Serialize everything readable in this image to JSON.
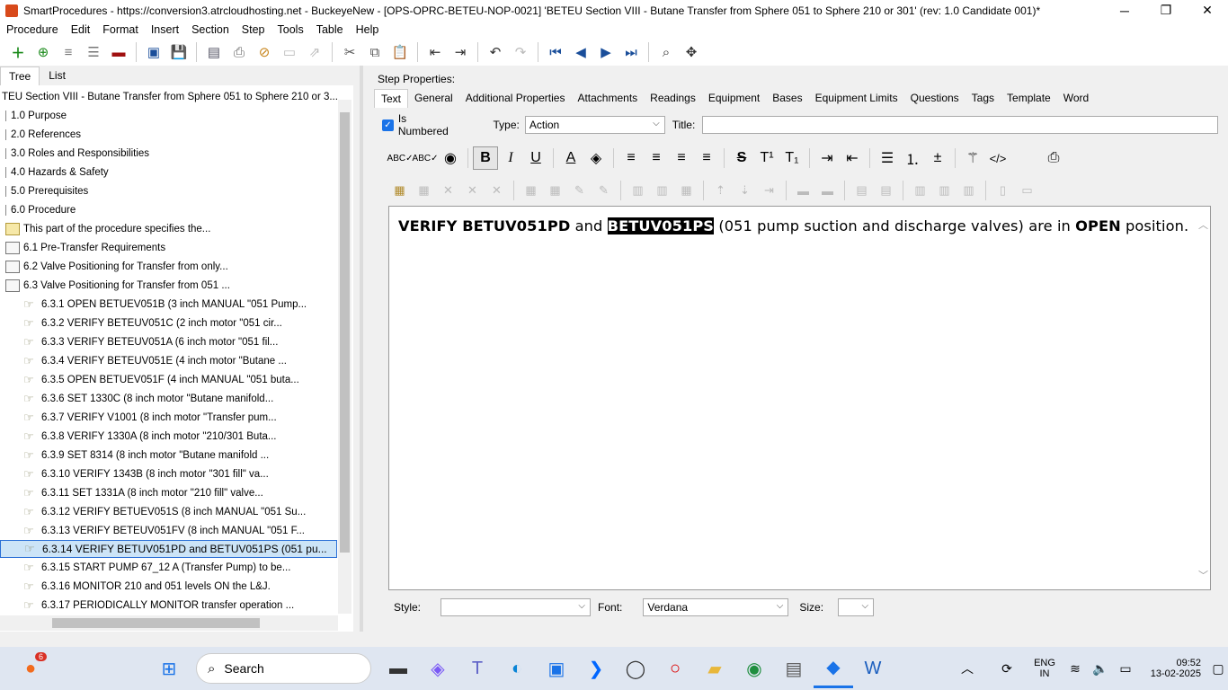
{
  "window": {
    "title": "SmartProcedures - https://conversion3.atrcloudhosting.net - BuckeyeNew - [OPS-OPRC-BETEU-NOP-0021] 'BETEU Section VIII - Butane Transfer from Sphere 051 to Sphere 210 or 301' (rev: 1.0 Candidate 001)*",
    "minimize": "─",
    "maximize": "❐",
    "close": "✕"
  },
  "menu": [
    "Procedure",
    "Edit",
    "Format",
    "Insert",
    "Section",
    "Step",
    "Tools",
    "Table",
    "Help"
  ],
  "left": {
    "tabs": [
      "Tree",
      "List"
    ],
    "tree": [
      {
        "label": "TEU Section VIII - Butane Transfer from Sphere 051 to Sphere 210 or 3...",
        "icon": "none",
        "indent": 0
      },
      {
        "label": "1.0 Purpose",
        "icon": "branch",
        "indent": 1
      },
      {
        "label": "2.0 References",
        "icon": "branch",
        "indent": 1
      },
      {
        "label": "3.0 Roles and Responsibilities",
        "icon": "branch",
        "indent": 1
      },
      {
        "label": "4.0 Hazards & Safety",
        "icon": "branch",
        "indent": 1
      },
      {
        "label": "5.0 Prerequisites",
        "icon": "branch",
        "indent": 1
      },
      {
        "label": "6.0 Procedure",
        "icon": "branch",
        "indent": 1
      },
      {
        "label": "This part of the procedure specifies the...",
        "icon": "note",
        "indent": 1
      },
      {
        "label": "6.1 Pre-Transfer Requirements",
        "icon": "doc",
        "indent": 1
      },
      {
        "label": "6.2 Valve Positioning for Transfer from only...",
        "icon": "doc",
        "indent": 1
      },
      {
        "label": "6.3 Valve Positioning for Transfer from 051 ...",
        "icon": "doc",
        "indent": 1
      },
      {
        "label": "6.3.1 OPEN BETUEV051B (3 inch MANUAL \"051 Pump...",
        "icon": "hand",
        "indent": 2
      },
      {
        "label": "6.3.2 VERIFY BETEUV051C (2 inch motor \"051 cir...",
        "icon": "hand",
        "indent": 2
      },
      {
        "label": "6.3.3 VERIFY BETEUV051A (6 inch motor \"051 fil...",
        "icon": "hand",
        "indent": 2
      },
      {
        "label": "6.3.4 VERIFY BETEUV051E (4 inch motor \"Butane ...",
        "icon": "hand",
        "indent": 2
      },
      {
        "label": "6.3.5 OPEN BETUEV051F (4 inch MANUAL \"051 buta...",
        "icon": "hand",
        "indent": 2
      },
      {
        "label": "6.3.6 SET 1330C (8 inch motor \"Butane manifold...",
        "icon": "hand",
        "indent": 2
      },
      {
        "label": "6.3.7 VERIFY V1001 (8 inch motor \"Transfer pum...",
        "icon": "hand",
        "indent": 2
      },
      {
        "label": "6.3.8 VERIFY 1330A (8 inch motor \"210/301 Buta...",
        "icon": "hand",
        "indent": 2
      },
      {
        "label": "6.3.9 SET 8314 (8 inch motor \"Butane manifold ...",
        "icon": "hand",
        "indent": 2
      },
      {
        "label": "6.3.10 VERIFY 1343B (8 inch motor \"301 fill\" va...",
        "icon": "hand",
        "indent": 2
      },
      {
        "label": "6.3.11 SET 1331A (8 inch motor \"210 fill\" valve...",
        "icon": "hand",
        "indent": 2
      },
      {
        "label": "6.3.12 VERIFY BETUEV051S (8 inch MANUAL \"051 Su...",
        "icon": "hand",
        "indent": 2
      },
      {
        "label": "6.3.13 VERIFY BETEUV051FV (8 inch MANUAL \"051 F...",
        "icon": "hand",
        "indent": 2
      },
      {
        "label": "6.3.14 VERIFY BETUV051PD and BETUV051PS (051 pu...",
        "icon": "hand",
        "indent": 2,
        "selected": true
      },
      {
        "label": "6.3.15 START PUMP 67_12 A (Transfer Pump) to be...",
        "icon": "hand",
        "indent": 2
      },
      {
        "label": "6.3.16 MONITOR 210 and 051 levels ON the L&J.",
        "icon": "hand",
        "indent": 2
      },
      {
        "label": "6.3.17 PERIODICALLY MONITOR transfer operation ...",
        "icon": "hand",
        "indent": 2
      }
    ]
  },
  "right": {
    "step_properties": "Step Properties:",
    "tabs": [
      "Text",
      "General",
      "Additional Properties",
      "Attachments",
      "Readings",
      "Equipment",
      "Bases",
      "Equipment Limits",
      "Questions",
      "Tags",
      "Template",
      "Word"
    ],
    "is_numbered_label": "Is Numbered",
    "type_label": "Type:",
    "type_value": "Action",
    "title_label": "Title:",
    "title_value": "",
    "editor": {
      "p1": "VERIFY BETUV051PD",
      "p2": " and ",
      "p3": "BETUV051PS",
      "p4": " (051 pump suction and discharge valves) are in ",
      "p5": "OPEN",
      "p6": " position."
    },
    "style_label": "Style:",
    "style_value": "",
    "font_label": "Font:",
    "font_value": "Verdana",
    "size_label": "Size:",
    "size_value": ""
  },
  "taskbar": {
    "search_placeholder": "Search",
    "badge": "6",
    "lang1": "ENG",
    "lang2": "IN",
    "time": "09:52",
    "date": "13-02-2025"
  },
  "colors": {
    "accent": "#2a6fd6",
    "selection": "#cce4f7",
    "highlight": "#000000"
  }
}
